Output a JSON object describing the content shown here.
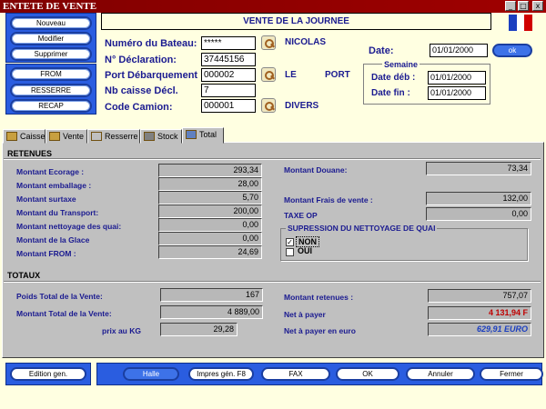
{
  "window": {
    "title": "ENTETE DE VENTE",
    "min": "_",
    "max": "□",
    "close": "x"
  },
  "nav": [
    "Nouveau",
    "Modifier",
    "Supprimer",
    "FROM",
    "RESSERRE",
    "RECAP"
  ],
  "header": {
    "title": "VENTE DE LA JOURNEE",
    "ok_label": "ok"
  },
  "form": {
    "bateau_label": "Numéro du Bateau:",
    "bateau_value": "*****",
    "bateau_name": "NICOLAS",
    "declaration_label": "N° Déclaration:",
    "declaration_value": "37445156",
    "port_label": "Port Débarquement",
    "port_value": "000002",
    "port_name_1": "LE",
    "port_name_2": "PORT",
    "caisse_label": "Nb caisse Décl.",
    "caisse_value": "7",
    "camion_label": "Code Camion:",
    "camion_value": "000001",
    "camion_name": "DIVERS",
    "date_label": "Date:",
    "date_value": "01/01/2000",
    "semaine_label": "Semaine",
    "date_deb_label": "Date déb :",
    "date_deb_value": "01/01/2000",
    "date_fin_label": "Date fin :",
    "date_fin_value": "01/01/2000"
  },
  "tabs": [
    "Caisse",
    "Vente",
    "Resserre",
    "Stock",
    "Total"
  ],
  "retenues": {
    "title": "RETENUES",
    "left": [
      {
        "label": "Montant Ecorage :",
        "value": "293,34"
      },
      {
        "label": "Montant emballage :",
        "value": "28,00"
      },
      {
        "label": "Montant surtaxe",
        "value": "5,70"
      },
      {
        "label": "Montant du Transport:",
        "value": "200,00"
      },
      {
        "label": "Montant nettoyage des quai:",
        "value": "0,00"
      },
      {
        "label": "Montant de la Glace",
        "value": "0,00"
      },
      {
        "label": "Montant FROM :",
        "value": "24,69"
      }
    ],
    "douane_label": "Montant Douane:",
    "douane_value": "73,34",
    "frais_label": "Montant Frais de vente :",
    "frais_value": "132,00",
    "taxe_label": "TAXE OP",
    "taxe_value": "0,00",
    "supp_title": "SUPRESSION DU NETTOYAGE DE QUAI",
    "non_label": "NON",
    "oui_label": "OUI",
    "non_mark": "✓"
  },
  "totaux": {
    "title": "TOTAUX",
    "poids_label": "Poids Total de la Vente:",
    "poids_value": "167",
    "montant_label": "Montant Total de la Vente:",
    "montant_value": "4 889,00",
    "prix_label": "prix au KG",
    "prix_value": "29,28",
    "retenues_label": "Montant retenues :",
    "retenues_value": "757,07",
    "net_label": "Net à payer",
    "net_value": "4 131,94 F",
    "euro_label": "Net à payer en euro",
    "euro_value": "629,91 EURO"
  },
  "footer": {
    "edition": "Edition gen.",
    "halle": "Halle",
    "impres": "Impres gén. F8",
    "fax": "FAX",
    "ok": "OK",
    "annuler": "Annuler",
    "fermer": "Fermer"
  },
  "colors": {
    "title_bar": "#800000",
    "label_blue": "#1a1a90",
    "net_red": "#c00000",
    "euro_blue": "#1a3ec0"
  }
}
